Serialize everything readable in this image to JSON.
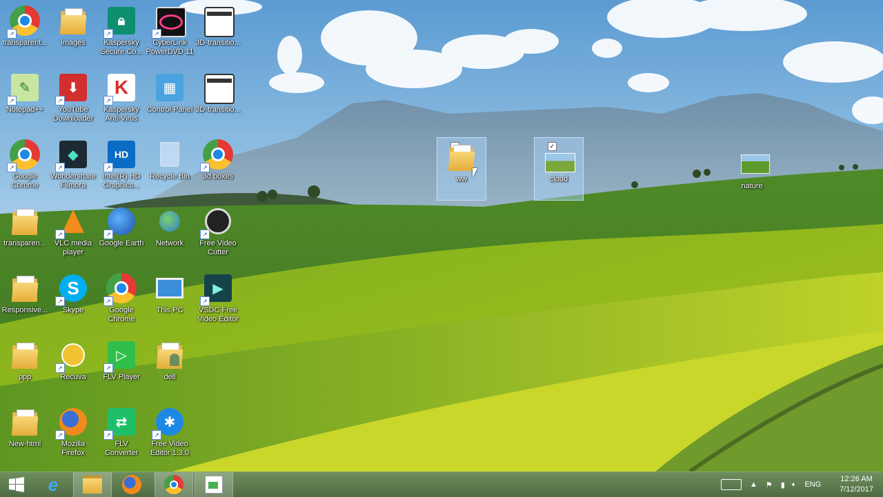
{
  "desktop_icons": [
    {
      "label": "transparent...",
      "kind": "chrome"
    },
    {
      "label": "images",
      "kind": "folder"
    },
    {
      "label": "Kaspersky Secure Co...",
      "kind": "kaspersky-secure"
    },
    {
      "label": "CyberLink PowerDVD 11",
      "kind": "powerdvd"
    },
    {
      "label": "3D-transitio...",
      "kind": "window"
    },
    {
      "label": "Notepad++",
      "kind": "notepad"
    },
    {
      "label": "YouTube Downloader",
      "kind": "downloader"
    },
    {
      "label": "Kaspersky Anti-Virus",
      "kind": "kaspersky-av"
    },
    {
      "label": "Control Panel",
      "kind": "control-panel"
    },
    {
      "label": "3D-transitio...",
      "kind": "window"
    },
    {
      "label": "Google Chrome",
      "kind": "chrome"
    },
    {
      "label": "Wondershare Filmora",
      "kind": "filmora"
    },
    {
      "label": "Intel(R) HD Graphics...",
      "kind": "intel"
    },
    {
      "label": "Recycle Bin",
      "kind": "recycle"
    },
    {
      "label": "3d boxes",
      "kind": "chrome"
    },
    {
      "label": "transparen...",
      "kind": "folder"
    },
    {
      "label": "VLC media player",
      "kind": "vlc"
    },
    {
      "label": "Google Earth",
      "kind": "earth"
    },
    {
      "label": "Network",
      "kind": "network"
    },
    {
      "label": "Free Video Cutter",
      "kind": "videocutter"
    },
    {
      "label": "Responsive...",
      "kind": "folder"
    },
    {
      "label": "Skype",
      "kind": "skype"
    },
    {
      "label": "Google Chrome",
      "kind": "chrome"
    },
    {
      "label": "This PC",
      "kind": "thispc"
    },
    {
      "label": "VSDC Free Video Editor",
      "kind": "vsdc"
    },
    {
      "label": "ppp",
      "kind": "folder"
    },
    {
      "label": "Recuva",
      "kind": "recuva"
    },
    {
      "label": "FLV Player",
      "kind": "flvplayer"
    },
    {
      "label": "dell",
      "kind": "folder-user"
    },
    {
      "label": "New-html",
      "kind": "folder"
    },
    {
      "label": "Mozilla Firefox",
      "kind": "firefox"
    },
    {
      "label": "FLV Converter",
      "kind": "flvconverter"
    },
    {
      "label": "Free Video Editor 1.3.0",
      "kind": "videoeditor"
    }
  ],
  "selected_icons": [
    {
      "label": "ww",
      "kind": "folder"
    },
    {
      "label": "cloud",
      "kind": "image"
    }
  ],
  "nature_icon": {
    "label": "nature",
    "kind": "image"
  },
  "taskbar": {
    "pinned": [
      "windows-start-icon",
      "internet-explorer-icon",
      "file-explorer-icon",
      "firefox-icon",
      "chrome-icon",
      "paint-icon"
    ],
    "language": "ENG",
    "time": "12:26 AM",
    "date": "7/12/2017"
  }
}
